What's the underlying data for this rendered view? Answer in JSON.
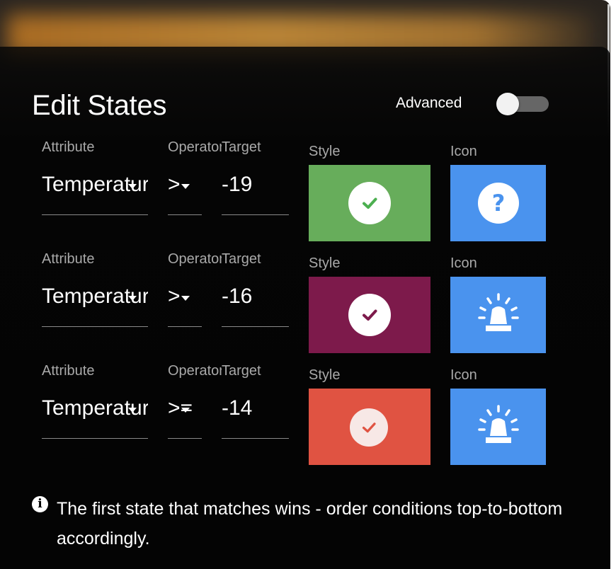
{
  "header": {
    "title": "Edit States",
    "advanced_label": "Advanced",
    "advanced_enabled": false
  },
  "labels": {
    "attribute": "Attribute",
    "operator": "Operator",
    "target": "Target",
    "style": "Style",
    "icon": "Icon"
  },
  "states": [
    {
      "attribute": "Temperature",
      "operator": ">",
      "target": "-19",
      "style_color": "#67ad5b",
      "check_color": "#4caf50",
      "icon": "question-icon"
    },
    {
      "attribute": "Temperature",
      "operator": ">",
      "target": "-16",
      "style_color": "#7d1a4b",
      "check_color": "#7d1a4b",
      "icon": "siren-icon"
    },
    {
      "attribute": "Temperature",
      "operator": ">=",
      "target": "-14",
      "style_color": "#e05342",
      "check_color": "#e05342",
      "icon": "siren-icon"
    }
  ],
  "icon_bg_color": "#4a93ee",
  "note": "The first state that matches wins - order conditions top-to-bottom accordingly."
}
